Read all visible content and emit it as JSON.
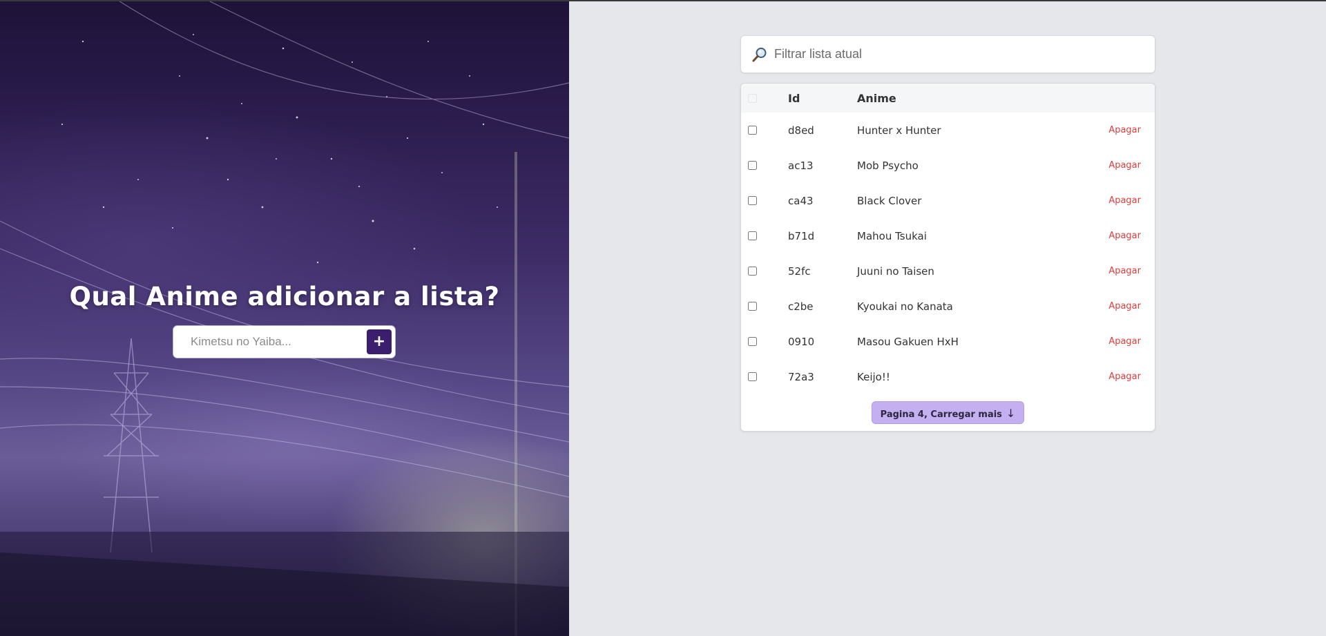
{
  "hero": {
    "title": "Qual Anime adicionar a lista?",
    "input_placeholder": "Kimetsu no Yaiba...",
    "add_button_label": "+"
  },
  "filter": {
    "placeholder": "Filtrar lista atual",
    "icon": "search-icon"
  },
  "table": {
    "columns": {
      "id": "Id",
      "anime": "Anime"
    },
    "delete_label": "Apagar",
    "rows": [
      {
        "id": "d8ed",
        "anime": "Hunter x Hunter"
      },
      {
        "id": "ac13",
        "anime": "Mob Psycho"
      },
      {
        "id": "ca43",
        "anime": "Black Clover"
      },
      {
        "id": "b71d",
        "anime": "Mahou Tsukai"
      },
      {
        "id": "52fc",
        "anime": "Juuni no Taisen"
      },
      {
        "id": "c2be",
        "anime": "Kyoukai no Kanata"
      },
      {
        "id": "0910",
        "anime": "Masou Gakuen HxH"
      },
      {
        "id": "72a3",
        "anime": "Keijo!!"
      }
    ]
  },
  "load_more": {
    "label": "Pagina 4, Carregar mais",
    "arrow": "↓"
  },
  "colors": {
    "accent": "#3b1f6e",
    "load_more_bg": "#c4b0f0",
    "delete": "#e03b3b",
    "page_bg": "#e5e7eb"
  }
}
